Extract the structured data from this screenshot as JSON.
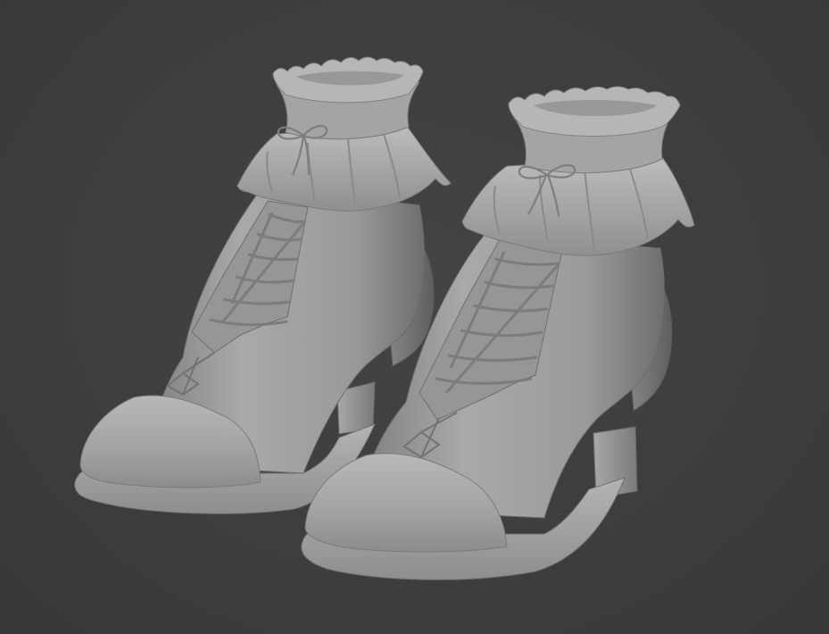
{
  "scene": {
    "background_color": "#3d3d3d",
    "material_color": "#a6a6a6",
    "material_shadow_color": "#6a6a6a",
    "material_highlight_color": "#c9c9c9",
    "objects": [
      "left-shoe",
      "right-shoe"
    ]
  }
}
